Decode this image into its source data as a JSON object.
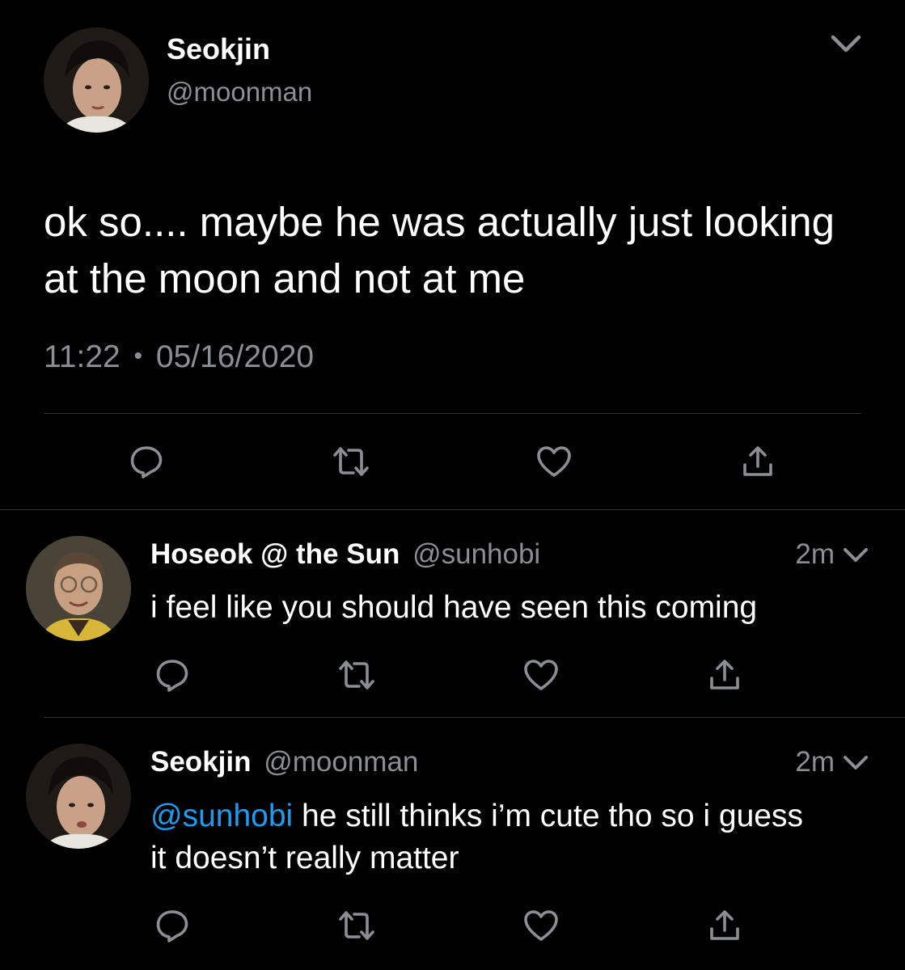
{
  "main_tweet": {
    "display_name": "Seokjin",
    "handle": "@moonman",
    "text": "ok so.... maybe he was actually just looking at the moon and not at me",
    "time": "11:22",
    "separator": "•",
    "date": "05/16/2020",
    "avatar_icon": "profile-photo",
    "menu_icon": "chevron-down-icon"
  },
  "replies": [
    {
      "display_name": "Hoseok @ the Sun",
      "handle": "@sunhobi",
      "time": "2m",
      "text": "i feel like you should have seen this coming",
      "avatar_icon": "profile-photo"
    },
    {
      "display_name": "Seokjin",
      "handle": "@moonman",
      "time": "2m",
      "mention": "@sunhobi",
      "text": " he still thinks i’m cute tho so i guess it doesn’t really matter",
      "avatar_icon": "profile-photo"
    }
  ],
  "action_icons": [
    "reply-icon",
    "retweet-icon",
    "like-icon",
    "share-icon"
  ],
  "colors": {
    "background": "#000000",
    "text": "#ffffff",
    "secondary_text": "#8b8f94",
    "mention": "#1d9bf0",
    "divider": "#2f3336"
  }
}
